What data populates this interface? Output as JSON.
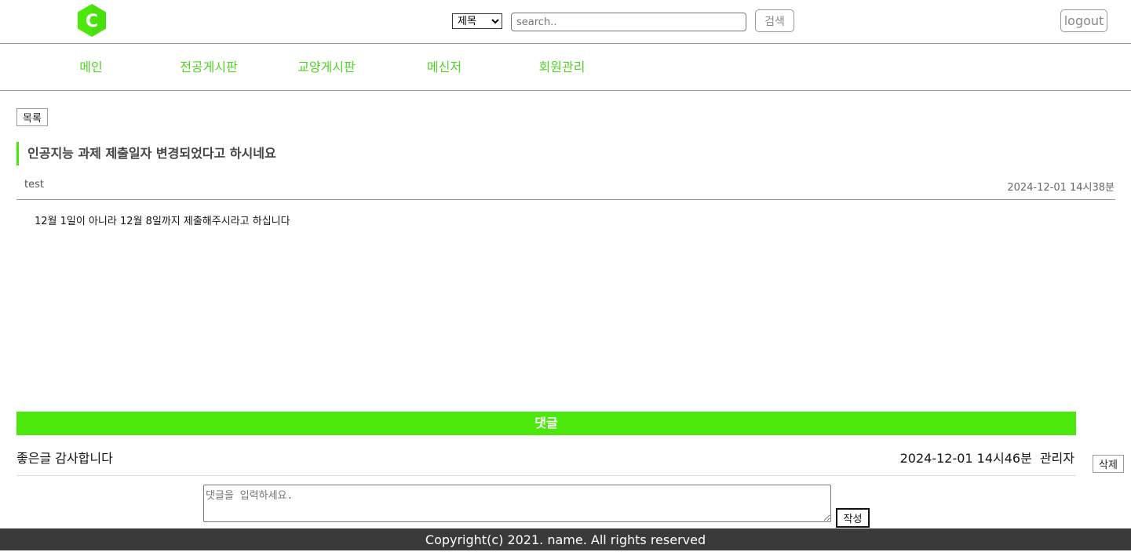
{
  "header": {
    "logo_letter": "C",
    "search_type_selected": "제목",
    "search_placeholder": "search..",
    "search_button": "검색",
    "logout_button": "logout"
  },
  "nav": {
    "items": [
      {
        "label": "메인"
      },
      {
        "label": "전공게시판"
      },
      {
        "label": "교양게시판"
      },
      {
        "label": "메신저"
      },
      {
        "label": "회원관리"
      }
    ]
  },
  "post": {
    "list_button": "목록",
    "title": "인공지능 과제 제출일자 변경되었다고 하시네요",
    "author": "test",
    "date": "2024-12-01 14시38분",
    "body": "12월 1일이 아니라 12월 8일까지 제출해주시라고 하십니다"
  },
  "comments": {
    "header": "댓글",
    "items": [
      {
        "text": "좋은글 감사합니다",
        "date": "2024-12-01 14시46분",
        "author": "관리자",
        "delete_button": "삭제"
      }
    ],
    "input_placeholder": "댓글을 입력하세요.",
    "write_button": "작성"
  },
  "footer": {
    "copyright": "Copyright(c) 2021. name. All rights reserved"
  },
  "colors": {
    "accent": "#4de80b",
    "nav_text": "#4fd625",
    "footer_bg": "#3a3a3a"
  }
}
